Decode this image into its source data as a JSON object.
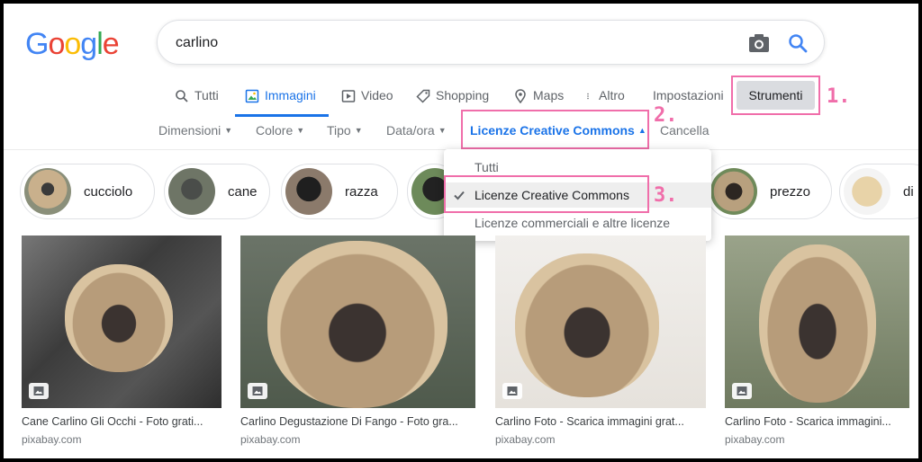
{
  "logo": [
    "G",
    "o",
    "o",
    "g",
    "l",
    "e"
  ],
  "search": {
    "value": "carlino"
  },
  "tabs": [
    {
      "label": "Tutti",
      "icon": "search-icon"
    },
    {
      "label": "Immagini",
      "icon": "image-icon",
      "active": true
    },
    {
      "label": "Video",
      "icon": "play-icon"
    },
    {
      "label": "Shopping",
      "icon": "tag-icon"
    },
    {
      "label": "Maps",
      "icon": "pin-icon"
    },
    {
      "label": "Altro",
      "icon": "more-icon"
    }
  ],
  "settings_label": "Impostazioni",
  "tools_label": "Strumenti",
  "steps": [
    "1.",
    "2.",
    "3."
  ],
  "filters": {
    "size": "Dimensioni",
    "color": "Colore",
    "type": "Tipo",
    "date": "Data/ora",
    "license": "Licenze Creative Commons",
    "clear": "Cancella"
  },
  "chips": [
    "cucciolo",
    "cane",
    "razza",
    "prezzo",
    "di"
  ],
  "license_menu": {
    "items": [
      "Tutti",
      "Licenze Creative Commons",
      "Licenze commerciali e altre licenze"
    ],
    "selected": "Licenze Creative Commons"
  },
  "results": [
    {
      "title": "Cane Carlino Gli Occhi - Foto grati...",
      "source": "pixabay.com"
    },
    {
      "title": "Carlino Degustazione Di Fango - Foto gra...",
      "source": "pixabay.com"
    },
    {
      "title": "Carlino Foto - Scarica immagini grat...",
      "source": "pixabay.com"
    },
    {
      "title": "Carlino Foto - Scarica immagini...",
      "source": "pixabay.com"
    }
  ],
  "colors": {
    "accent": "#1a73e8",
    "highlight": "#f06eaa"
  }
}
